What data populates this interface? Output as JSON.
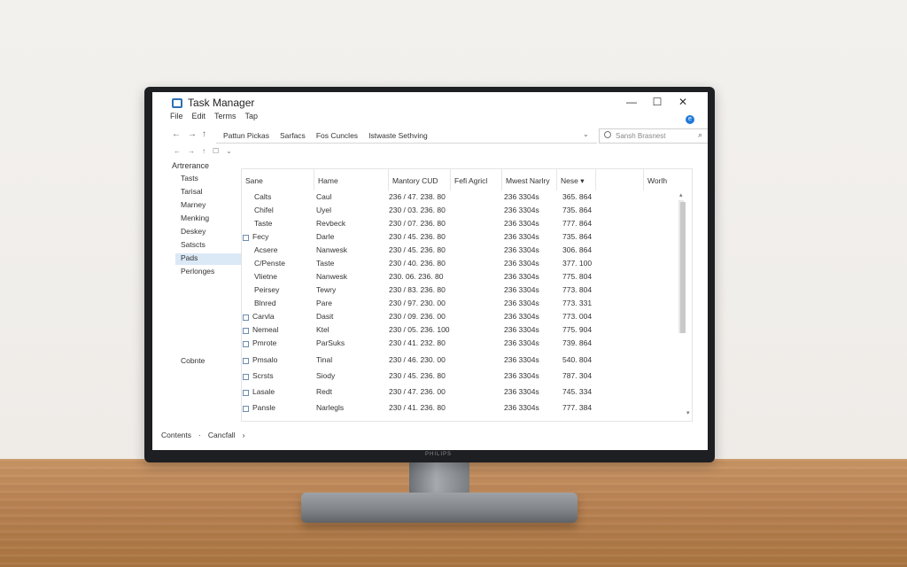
{
  "window": {
    "title": "Task Manager",
    "controls": {
      "minimize": "—",
      "maximize": "☐",
      "close": "✕"
    }
  },
  "menu": [
    "File",
    "Edit",
    "Terms",
    "Tap"
  ],
  "help_badge": "e",
  "nav": {
    "back": "←",
    "forward": "→",
    "up": "↑",
    "address": [
      "Pattun Pickas",
      "Sarfacs",
      "Fos Cuncles",
      "Istwaste Sethving"
    ],
    "address_chevron": "⌄",
    "search_placeholder": "Sansh Brasnest",
    "search_go": "⌕"
  },
  "toolbar2": [
    "←",
    "→",
    "↑",
    "☐",
    "⌄"
  ],
  "sidebar": {
    "heading": "Artrerance",
    "items": [
      "Tasts",
      "Tarisal",
      "Marney",
      "Menking",
      "Deskey",
      "Satscts",
      "Pads",
      "Perlonges"
    ],
    "active_index": 6,
    "other": "Cobnte"
  },
  "table": {
    "columns": [
      "Sane",
      "Hame",
      "Mantory CUD",
      "Fefi Agricl",
      "Mwest Narlry",
      "Nese",
      "Worlh"
    ],
    "sort_indicator": "▾",
    "rows": [
      {
        "name": "Calts",
        "type": "Caul",
        "memory": "236 / 47. 238. 80",
        "extra": "",
        "stat": "236 3304s",
        "num": "365. 864",
        "icon": false
      },
      {
        "name": "Chifel",
        "type": "Uyel",
        "memory": "230 / 03. 236. 80",
        "extra": "",
        "stat": "236 3304s",
        "num": "735. 864",
        "icon": false
      },
      {
        "name": "Taste",
        "type": "Revbeck",
        "memory": "230 / 07. 236. 80",
        "extra": "",
        "stat": "236 3304s",
        "num": "777. 864",
        "icon": false
      },
      {
        "name": "Fecy",
        "type": "Darle",
        "memory": "230 / 45. 236. 80",
        "extra": "",
        "stat": "236 3304s",
        "num": "735. 864",
        "icon": true
      },
      {
        "name": "Acsere",
        "type": "Nanwesk",
        "memory": "230 / 45. 236. 80",
        "extra": "",
        "stat": "236 3304s",
        "num": "306. 864",
        "icon": false
      },
      {
        "name": "C/Penste",
        "type": "Taste",
        "memory": "230 / 40. 236. 80",
        "extra": "",
        "stat": "236 3304s",
        "num": "377. 100",
        "icon": false
      },
      {
        "name": "Vlietne",
        "type": "Nanwesk",
        "memory": "230. 06. 236. 80",
        "extra": "",
        "stat": "236 3304s",
        "num": "775. 804",
        "icon": false
      },
      {
        "name": "Peirsey",
        "type": "Tewry",
        "memory": "230 / 83. 236. 80",
        "extra": "",
        "stat": "236 3304s",
        "num": "773. 804",
        "icon": false
      },
      {
        "name": "Blnred",
        "type": "Pare",
        "memory": "230 / 97. 230. 00",
        "extra": "",
        "stat": "236 3304s",
        "num": "773. 331",
        "icon": false
      },
      {
        "name": "Carvla",
        "type": "Dasit",
        "memory": "230 / 09. 236. 00",
        "extra": "",
        "stat": "236 3304s",
        "num": "773. 004",
        "icon": true
      },
      {
        "name": "Nemeal",
        "type": "Ktel",
        "memory": "230 / 05. 236. 100",
        "extra": "",
        "stat": "236 3304s",
        "num": "775. 904",
        "icon": true
      },
      {
        "name": "Pmrote",
        "type": "ParSuks",
        "memory": "230 / 41. 232. 80",
        "extra": "",
        "stat": "236 3304s",
        "num": "739. 864",
        "icon": true
      },
      {
        "name": "Pmsalo",
        "type": "Tinal",
        "memory": "230 / 46. 230. 00",
        "extra": "",
        "stat": "236 3304s",
        "num": "540. 804",
        "icon": true
      },
      {
        "name": "Scrsts",
        "type": "Siody",
        "memory": "230 / 45. 236. 80",
        "extra": "",
        "stat": "236 3304s",
        "num": "787. 304",
        "icon": true
      },
      {
        "name": "Lasale",
        "type": "Redt",
        "memory": "230 / 47. 236. 00",
        "extra": "",
        "stat": "236 3304s",
        "num": "745. 334",
        "icon": true
      },
      {
        "name": "Pansle",
        "type": "Narlegls",
        "memory": "230 / 41. 236. 80",
        "extra": "",
        "stat": "236 3304s",
        "num": "777. 384",
        "icon": true
      }
    ]
  },
  "scroll": {
    "up": "▴",
    "down": "▾"
  },
  "statusbar": [
    "Contents",
    "·",
    "Cancfall",
    "›"
  ],
  "brand": "PHILIPS"
}
